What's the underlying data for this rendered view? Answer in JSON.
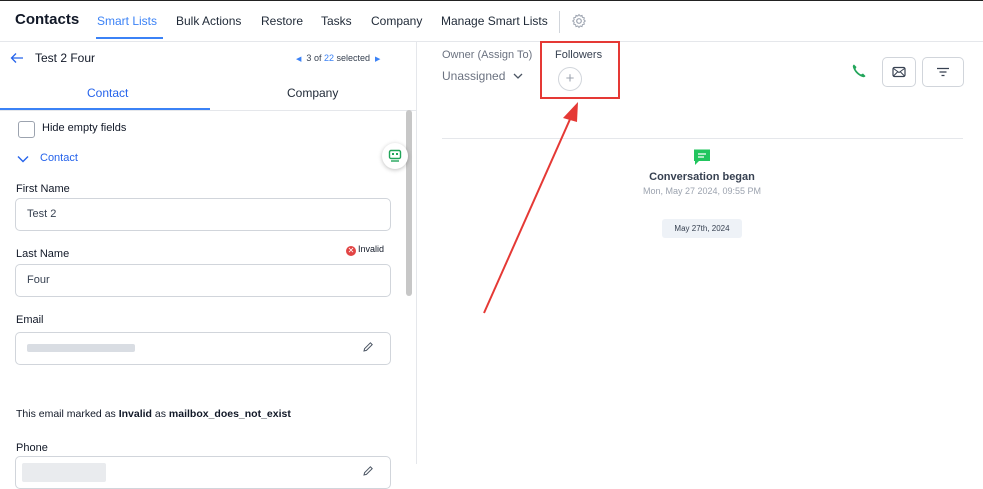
{
  "app": {
    "title": "Contacts"
  },
  "nav": {
    "tabs": [
      "Smart Lists",
      "Bulk Actions",
      "Restore",
      "Tasks",
      "Company",
      "Manage Smart Lists"
    ],
    "active_tab": "Smart Lists"
  },
  "contact": {
    "name": "Test 2 Four",
    "pager": {
      "current": "3",
      "of_label": "of",
      "total": "22",
      "suffix": "selected"
    }
  },
  "subtabs": {
    "contact": "Contact",
    "company": "Company",
    "active": "Contact"
  },
  "panel": {
    "hide_empty_label": "Hide empty fields",
    "section_label": "Contact"
  },
  "fields": {
    "first_name": {
      "label": "First Name",
      "value": "Test 2"
    },
    "last_name": {
      "label": "Last Name",
      "value": "Four"
    },
    "email": {
      "label": "Email",
      "status": "Invalid",
      "note_prefix": "This email marked as",
      "note_status": "Invalid",
      "note_middle": "as",
      "note_reason": "mailbox_does_not_exist"
    },
    "phone": {
      "label": "Phone"
    }
  },
  "assignment": {
    "owner_label": "Owner (Assign To)",
    "owner_value": "Unassigned",
    "followers_label": "Followers",
    "add_follower_symbol": "+"
  },
  "conversation": {
    "title": "Conversation began",
    "timestamp": "Mon, May 27 2024, 09:55 PM",
    "date_chip": "May 27th, 2024"
  },
  "colors": {
    "accent": "#3b82f6",
    "invalid": "#e24444",
    "highlight": "#e53935",
    "phone": "#22a55a",
    "chat": "#22c55e"
  },
  "icons": [
    "back-arrow-icon",
    "gear-icon",
    "chevron-down-icon",
    "pencil-icon",
    "phone-icon",
    "mail-icon",
    "filter-icon",
    "chat-icon",
    "sms-icon"
  ]
}
